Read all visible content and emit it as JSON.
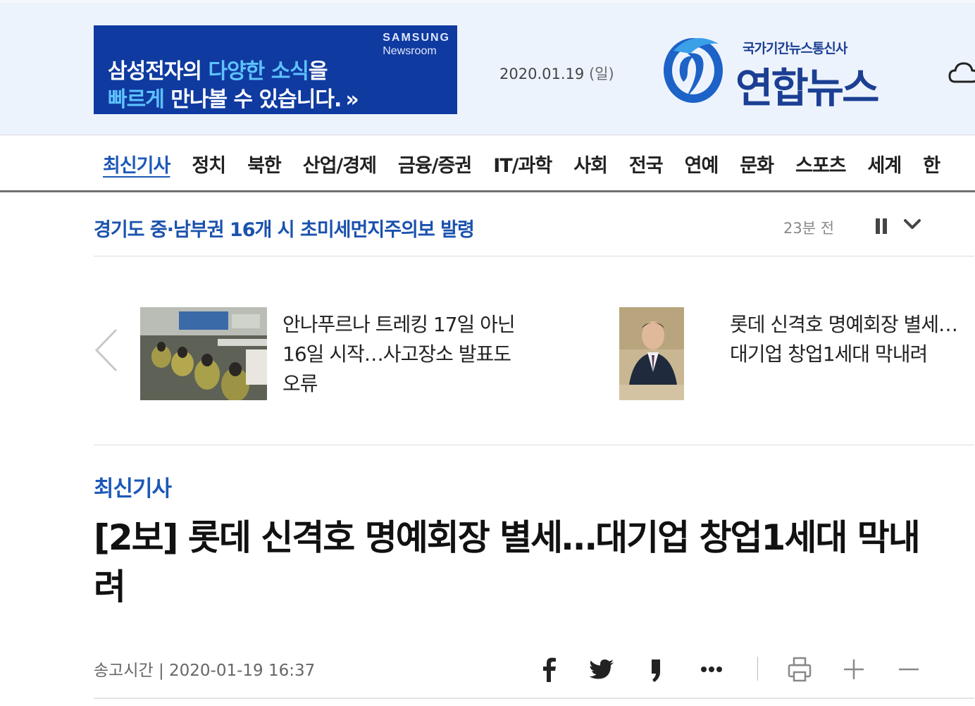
{
  "banner": {
    "brand_line1": "SAMSUNG",
    "brand_line2": "Newsroom",
    "line1_a": "삼성전자의 ",
    "line1_b": "다양한 소식",
    "line1_c": "을",
    "line2_a": "빠르게",
    "line2_b": " 만나볼 수 있습니다.",
    "arrow": "»"
  },
  "header": {
    "date": "2020.01.19",
    "day_of_week": "(일)",
    "logo_sub": "국가기간뉴스통신사",
    "logo_main": "연합뉴스"
  },
  "nav": {
    "items": [
      "최신기사",
      "정치",
      "북한",
      "산업/경제",
      "금융/증권",
      "IT/과학",
      "사회",
      "전국",
      "연예",
      "문화",
      "스포츠",
      "세계",
      "한"
    ],
    "active_index": 0
  },
  "ticker": {
    "headline": "경기도 중·남부권 16개 시 초미세먼지주의보 발령",
    "time_ago": "23분 전"
  },
  "slider": {
    "cards": [
      {
        "title": "안나푸르나 트레킹 17일 아닌 16일 시작…사고장소 발표도 오류"
      },
      {
        "title": "롯데 신격호 명예회장 별세…대기업 창업1세대 막내려"
      }
    ]
  },
  "article": {
    "section": "최신기사",
    "title": "[2보] 롯데 신격호 명예회장 별세…대기업 창업1세대 막내려",
    "published_label": "송고시간",
    "published_sep": " | ",
    "published_time": "2020-01-19 16:37"
  },
  "toolbar": {
    "icons": [
      "facebook-icon",
      "twitter-icon",
      "kakao-icon",
      "more-icon",
      "print-icon",
      "font-increase-icon",
      "font-decrease-icon"
    ]
  },
  "colors": {
    "brand_blue": "#1b3f93",
    "link_blue": "#1d58b8",
    "header_bg": "#edf3fd",
    "banner_bg": "#0f3aa0"
  }
}
